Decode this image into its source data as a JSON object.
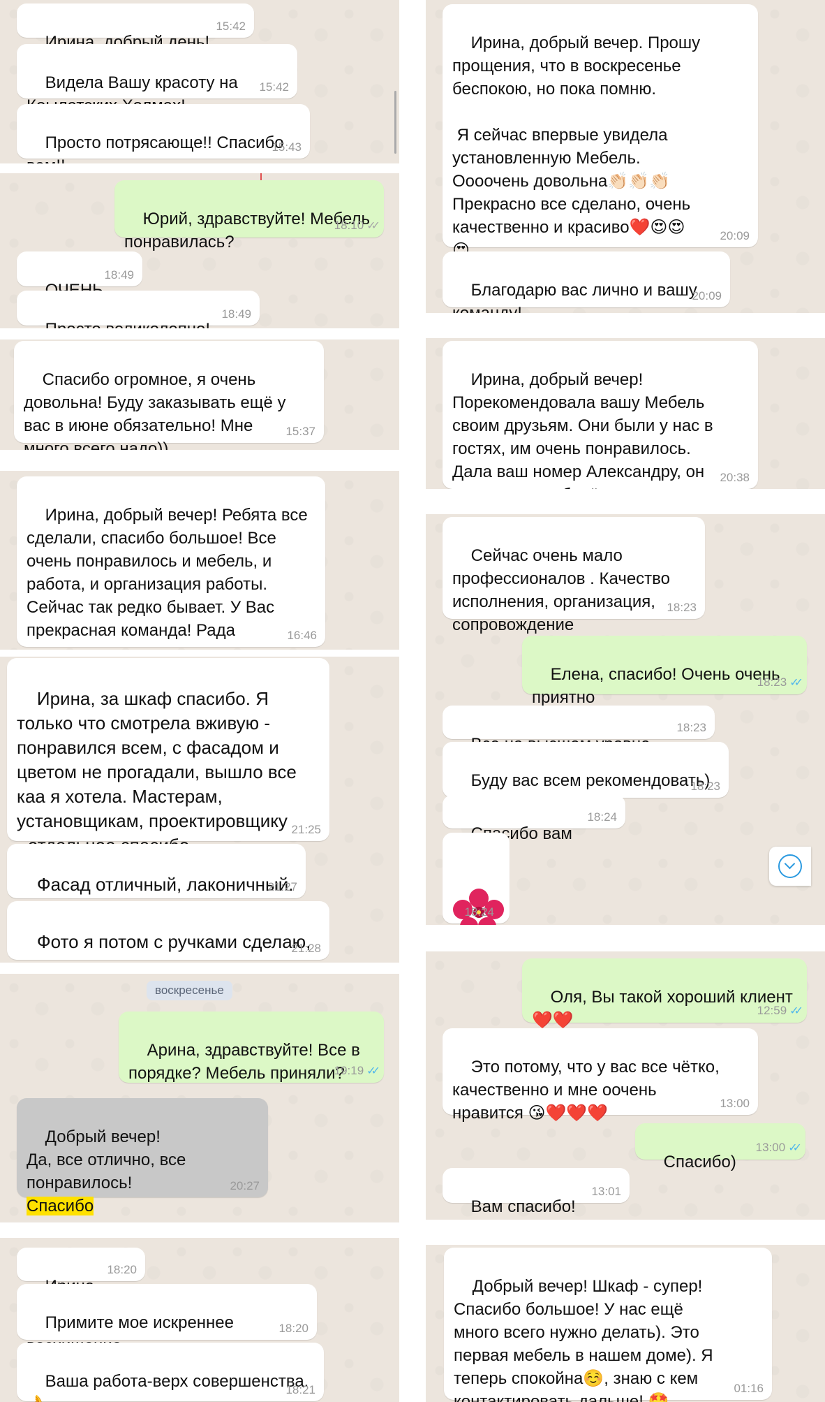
{
  "left": {
    "p1": {
      "m1": {
        "text": "Ирина, добрый день!",
        "time": "15:42"
      },
      "m2": {
        "text": "Видела Вашу красоту на\nКоылатских Холмах!",
        "time": "15:42"
      },
      "m3": {
        "text": "Просто потрясающе!! Спасибо\nвам!!",
        "time": "15:43"
      }
    },
    "p2": {
      "m1": {
        "text": "Юрий, здравствуйте! Мебель\nпонравилась?",
        "time": "18:10",
        "ticks": "✓✓"
      },
      "m2": {
        "text": "ОЧЕНЬ",
        "time": "18:49"
      },
      "m3": {
        "text": "Просто великолепно!",
        "time": "18:49"
      }
    },
    "p3": {
      "m1": {
        "text": "Спасибо огромное, я очень\nдовольна! Буду заказывать ещё у\nвас в июне обязательно! Мне\nмного всего надо))",
        "time": "15:37"
      }
    },
    "p4": {
      "m1": {
        "text": "Ирина, добрый вечер! Ребята все\nсделали, спасибо большое! Все\nочень понравилось и мебель, и\nработа, и организация работы.\nСейчас так редко бывает. У Вас\nпрекрасная команда! Рада\nзнакомству.",
        "time": "16:46"
      }
    },
    "p5": {
      "m1": {
        "text": "Ирина, за шкаф спасибо. Я\nтолько что смотрела вживую -\nпонравился всем, с фасадом и\nцветом не прогадали, вышло все\nкаа я хотела. Мастерам,\nустановщикам, проектировщику\n- отдельное спасибо",
        "time": "21:25"
      },
      "m2": {
        "text": "Фасад отличный, лаконичный.",
        "time": "21:27"
      },
      "m3": {
        "text": "Фото я потом с ручками сделаю,\nпришлю",
        "time": "21:28"
      }
    },
    "p6": {
      "date": "воскресенье",
      "m1": {
        "text": "Арина, здравствуйте! Все в\nпорядке? Мебель приняли?",
        "time": "19:19",
        "ticks": "✓✓"
      },
      "m2": {
        "text": "Добрый вечер!\nДа, все отлично, все\nпонравилось!",
        "highlight": "Спасибо",
        "time": "20:27"
      }
    },
    "p7": {
      "m1": {
        "text": "Ирина",
        "time": "18:20"
      },
      "m2": {
        "text": "Примите мое искреннее\nвосхищение",
        "time": "18:20"
      },
      "m3": {
        "text": "Ваша работа-верх совершенства.\n👌",
        "time": "18:21"
      }
    }
  },
  "right": {
    "p1": {
      "m1": {
        "text": "Ирина, добрый вечер. Прошу\nпрощения, что в воскресенье\nбеспокою, но пока помню.\n\n Я сейчас впервые увидела\nустановленную Мебель.\nОооочень довольна👏🏻👏🏻👏🏻\nПрекрасно все сделано, очень\nкачественно и красиво❤️😍😍\n😍",
        "time": "20:09"
      },
      "m2": {
        "text": "Благодарю вас лично и вашу\nкоманду!",
        "time": "20:09"
      }
    },
    "p2": {
      "m1": {
        "text": "Ирина, добрый вечер!\nПорекомендовала вашу Мебель\nсвоим друзьям. Они были у нас в\nгостях, им очень понравилось.\nДала ваш номер Александру, он\nзавтра вам наберёт",
        "time": "20:38"
      }
    },
    "p3": {
      "m1": {
        "text": "Сейчас очень мало\nпрофессионалов . Качество\nисполнения, организация,\nсопровождение",
        "time": "18:23"
      },
      "m2": {
        "text": "Елена, спасибо! Очень очень\nприятно",
        "time": "18:23",
        "ticks": "✓✓"
      },
      "m3": {
        "text": "Все на высшем уровне",
        "time": "18:23"
      },
      "m4": {
        "text": "Буду вас всем рекомендовать)",
        "time": "18:23"
      },
      "m5": {
        "text": "Спасибо вам",
        "time": "18:24"
      },
      "m6": {
        "time": "18:24"
      }
    },
    "p4": {
      "m1": {
        "text": "Оля, Вы такой хороший клиент\n❤️❤️",
        "time": "12:59",
        "ticks": "✓✓"
      },
      "m2": {
        "text": "Это потому, что у вас все чётко,\nкачественно и мне оочень\nнравится 😘❤️❤️❤️",
        "time": "13:00"
      },
      "m3": {
        "text": "Спасибо)",
        "time": "13:00",
        "ticks": "✓✓"
      },
      "m4": {
        "text": "Вам спасибо!",
        "time": "13:01"
      }
    },
    "p5": {
      "m1": {
        "text": "Добрый вечер! Шкаф - супер!\nСпасибо большое! У нас ещё\nмного всего нужно делать). Это\nпервая мебель в нашем доме). Я\nтеперь спокойна☺️, знаю с кем\nконтактировать дальше! 🤩",
        "time": "01:16"
      }
    }
  },
  "colors": {
    "incoming": "#ffffff",
    "outgoing": "#dcf8c6",
    "chat_bg": "#ece5dd",
    "read_ticks": "#4fb6ec",
    "highlight": "#ffe100"
  }
}
